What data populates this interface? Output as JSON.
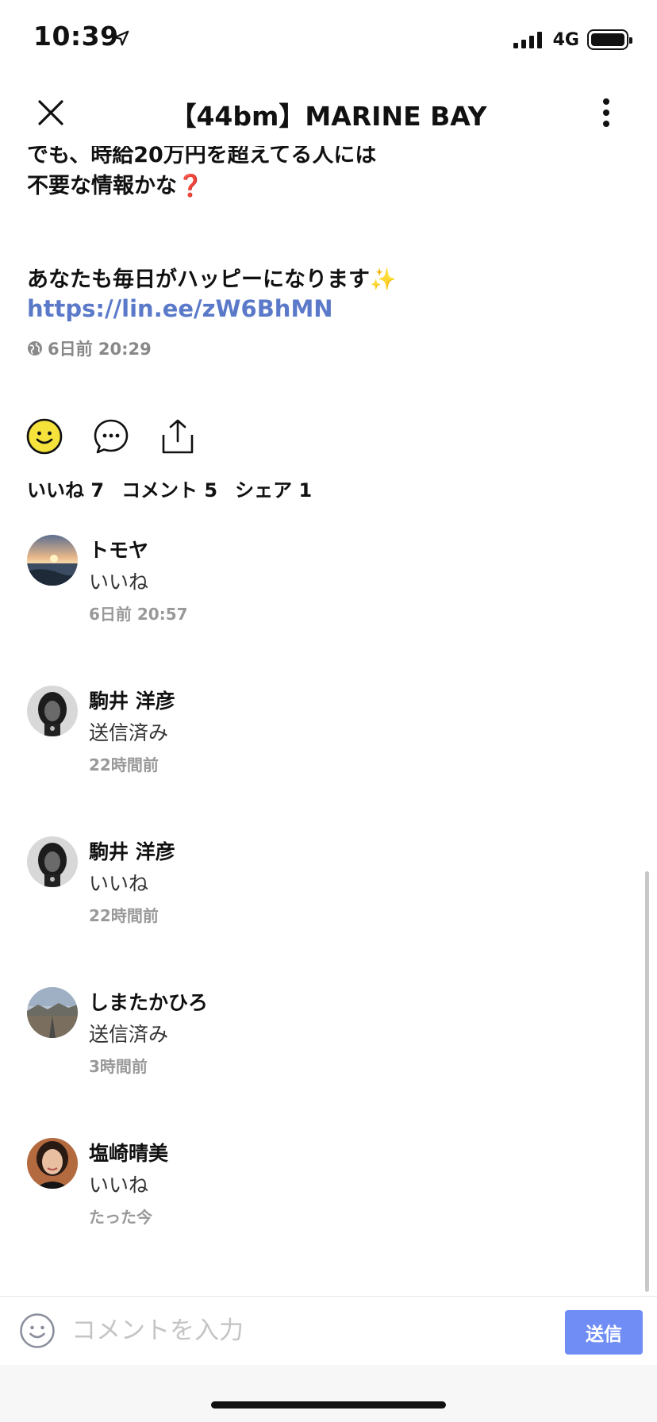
{
  "status_bar": {
    "time": "10:39",
    "network": "4G",
    "location_icon": "location-arrow-icon",
    "signal_icon": "signal-bars-icon",
    "battery_icon": "battery-icon"
  },
  "header": {
    "title": "【44bm】MARINE BAY",
    "close_icon": "close-icon",
    "more_icon": "more-vertical-icon"
  },
  "post": {
    "lines": [
      "でも、時給20万円を超えてる人には",
      "不要な情報かな",
      "",
      "あなたも毎日がハッピーになります"
    ],
    "line2_emoji": "❓",
    "line4_emoji": "✨",
    "link": "https://lin.ee/zW6BhMN",
    "meta_icon": "globe-icon",
    "timestamp": "6日前 20:29"
  },
  "actions": {
    "like_icon": "smiley-icon",
    "comment_icon": "comment-bubble-icon",
    "share_icon": "share-icon"
  },
  "counts": {
    "likes": "いいね 7",
    "comments": "コメント 5",
    "shares": "シェア 1"
  },
  "comments": [
    {
      "name": "トモヤ",
      "text": "いいね",
      "time": "6日前 20:57"
    },
    {
      "name": "駒井 洋彦",
      "text": "送信済み",
      "time": "22時間前"
    },
    {
      "name": "駒井 洋彦",
      "text": "いいね",
      "time": "22時間前"
    },
    {
      "name": "しまたかひろ",
      "text": "送信済み",
      "time": "3時間前"
    },
    {
      "name": "塩崎晴美",
      "text": "いいね",
      "time": "たった今"
    }
  ],
  "input_bar": {
    "placeholder": "コメントを入力",
    "send_label": "送信",
    "emoji_icon": "smiley-icon"
  },
  "colors": {
    "link": "#5b79c9",
    "send_button": "#6f8df5",
    "like_icon_fill": "#f5e33c"
  }
}
